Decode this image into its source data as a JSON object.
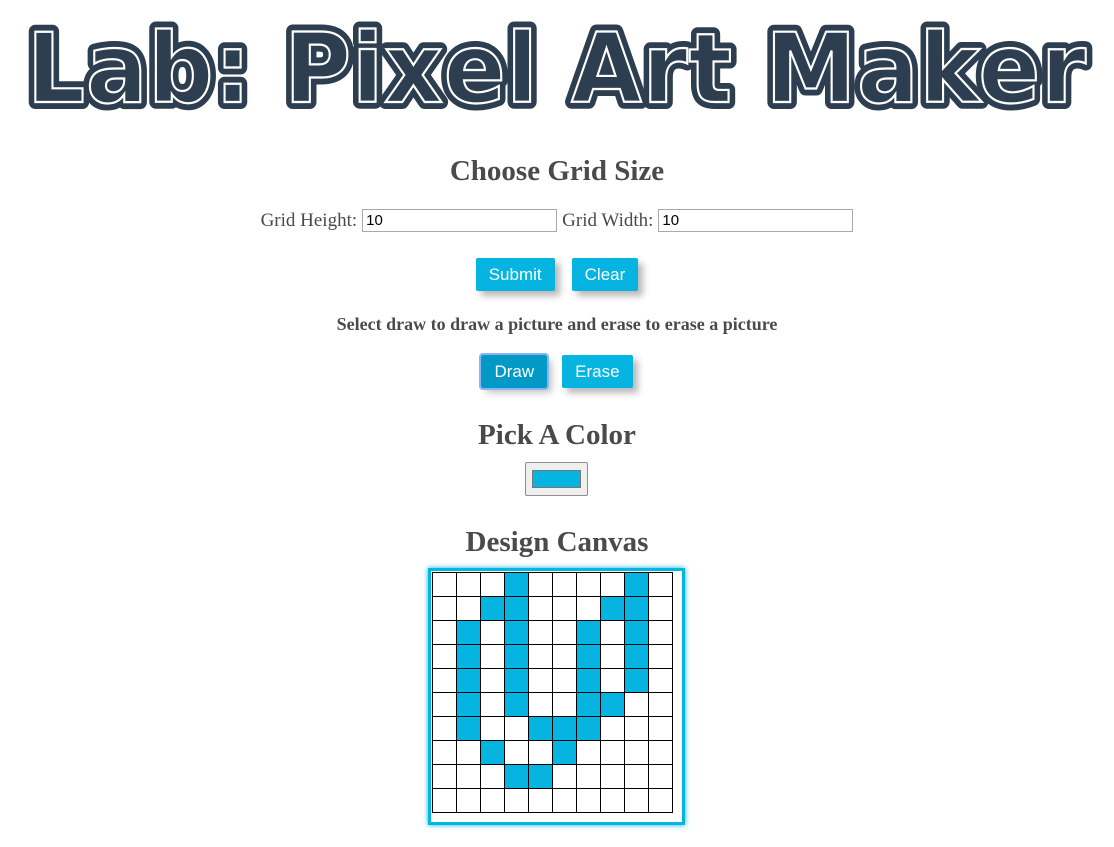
{
  "header": {
    "title": "Lab: Pixel Art Maker"
  },
  "grid_size": {
    "heading": "Choose Grid Size",
    "height_label": "Grid Height:",
    "height_value": "10",
    "width_label": "Grid Width:",
    "width_value": "10",
    "submit_label": "Submit",
    "clear_label": "Clear"
  },
  "mode": {
    "instruction": "Select draw to draw a picture and erase to erase a picture",
    "draw_label": "Draw",
    "erase_label": "Erase",
    "active": "draw"
  },
  "color_picker": {
    "heading": "Pick A Color",
    "value": "#05b4e0"
  },
  "canvas": {
    "heading": "Design Canvas",
    "rows": 10,
    "cols": 10,
    "fill_color": "#05b4e0",
    "filled_cells": [
      [
        0,
        3
      ],
      [
        0,
        8
      ],
      [
        1,
        2
      ],
      [
        1,
        3
      ],
      [
        1,
        7
      ],
      [
        1,
        8
      ],
      [
        2,
        1
      ],
      [
        2,
        3
      ],
      [
        2,
        6
      ],
      [
        2,
        8
      ],
      [
        3,
        1
      ],
      [
        3,
        3
      ],
      [
        3,
        6
      ],
      [
        3,
        8
      ],
      [
        4,
        1
      ],
      [
        4,
        3
      ],
      [
        4,
        6
      ],
      [
        4,
        8
      ],
      [
        5,
        1
      ],
      [
        5,
        3
      ],
      [
        5,
        6
      ],
      [
        5,
        7
      ],
      [
        6,
        1
      ],
      [
        6,
        4
      ],
      [
        6,
        5
      ],
      [
        6,
        6
      ],
      [
        7,
        2
      ],
      [
        7,
        5
      ],
      [
        8,
        3
      ],
      [
        8,
        4
      ]
    ]
  }
}
